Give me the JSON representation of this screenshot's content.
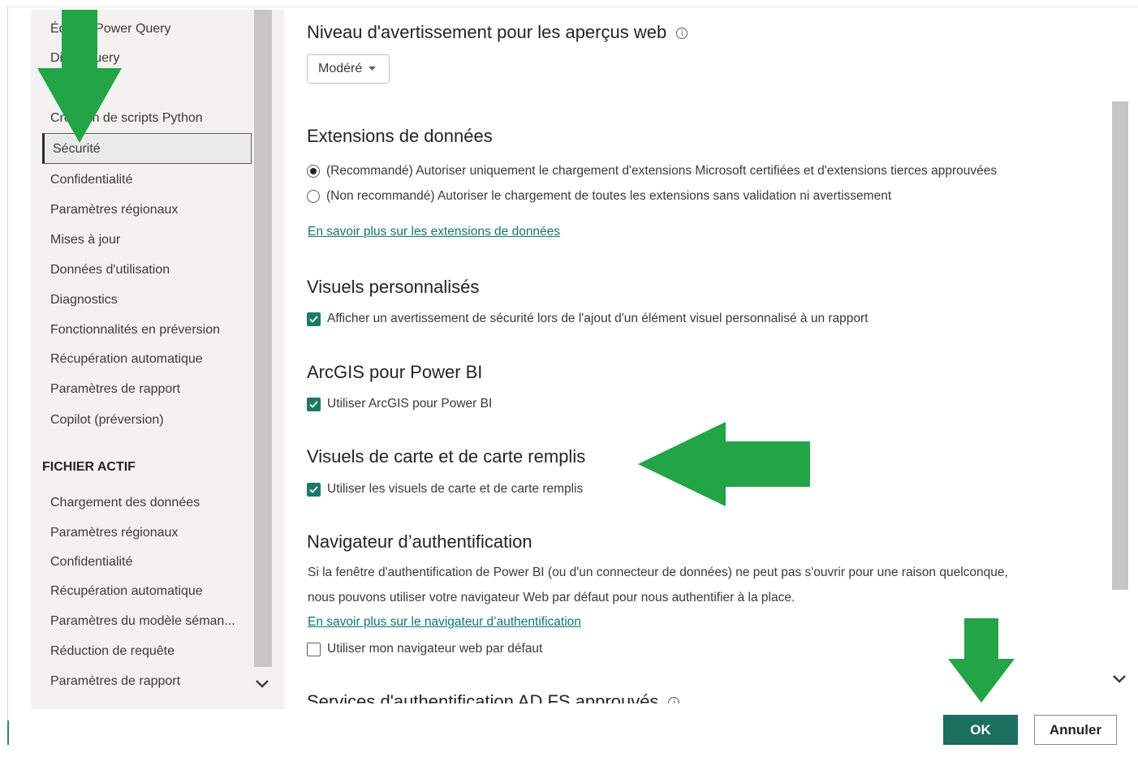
{
  "sidebar": {
    "items_top": [
      {
        "label": "Éditeur Power Query"
      },
      {
        "label": "DirectQuery"
      },
      {
        "label": "Création de scripts Python"
      },
      {
        "label": "Sécurité"
      },
      {
        "label": "Confidentialité"
      },
      {
        "label": "Paramètres régionaux"
      },
      {
        "label": "Mises à jour"
      },
      {
        "label": "Données d'utilisation"
      },
      {
        "label": "Diagnostics"
      },
      {
        "label": "Fonctionnalités en préversion"
      },
      {
        "label": "Récupération automatique"
      },
      {
        "label": "Paramètres de rapport"
      },
      {
        "label": "Copilot (préversion)"
      }
    ],
    "section_heading": "FICHIER ACTIF",
    "items_file": [
      {
        "label": "Chargement des données"
      },
      {
        "label": "Paramètres régionaux"
      },
      {
        "label": "Confidentialité"
      },
      {
        "label": "Récupération automatique"
      },
      {
        "label": "Paramètres du modèle séman..."
      },
      {
        "label": "Réduction de requête"
      },
      {
        "label": "Paramètres de rapport"
      }
    ],
    "selected": "Sécurité"
  },
  "main": {
    "web_preview": {
      "title": "Niveau d'avertissement pour les aperçus web",
      "dropdown_value": "Modéré"
    },
    "data_extensions": {
      "title": "Extensions de données",
      "option1": "(Recommandé) Autoriser uniquement le chargement d'extensions Microsoft certifiées et d'extensions tierces approuvées",
      "option2": "(Non recommandé) Autoriser le chargement de toutes les extensions sans validation ni avertissement",
      "selected_option": 1,
      "link": "En savoir plus sur les extensions de données"
    },
    "custom_visuals": {
      "title": "Visuels personnalisés",
      "checkbox": "Afficher un avertissement de sécurité lors de l'ajout d'un élément visuel personnalisé à un rapport",
      "checked": true
    },
    "arcgis": {
      "title": "ArcGIS pour Power BI",
      "checkbox": "Utiliser ArcGIS pour Power BI",
      "checked": true
    },
    "map_visuals": {
      "title": "Visuels de carte et de carte remplis",
      "checkbox": "Utiliser les visuels de carte et de carte remplis",
      "checked": true
    },
    "auth_browser": {
      "title": "Navigateur d’authentification",
      "line1": "Si la fenêtre d'authentification de Power BI (ou d'un connecteur de données) ne peut pas s'ouvrir pour une raison quelconque,",
      "line2": "nous pouvons utiliser votre navigateur Web par défaut pour nous authentifier à la place.",
      "link": "En savoir plus sur le navigateur d’authentification",
      "checkbox": "Utiliser mon navigateur web par défaut",
      "checked": false
    },
    "adfs": {
      "title": "Services d'authentification AD FS approuvés"
    }
  },
  "buttons": {
    "ok": "OK",
    "cancel": "Annuler"
  },
  "colors": {
    "accent": "#1d6f5f",
    "link": "#117865",
    "annotation_arrow": "#22a447",
    "sidebar_bg": "#f3f2f1"
  }
}
